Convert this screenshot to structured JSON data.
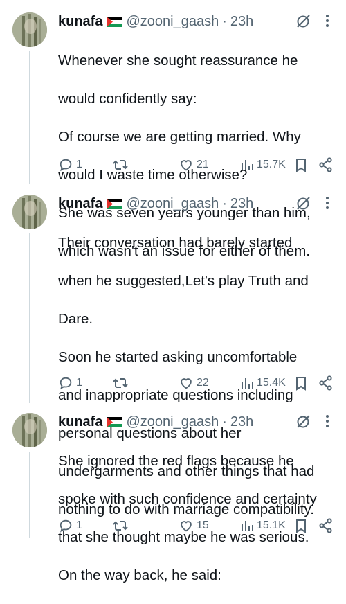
{
  "tweets": [
    {
      "name": "kunafa",
      "handle": "@zooni_gaash",
      "separator": "·",
      "time": "23h",
      "lines": [
        "Whenever she sought reassurance he",
        "would confidently say:",
        "Of course we are getting married. Why",
        "would I waste time otherwise?",
        "She was seven years younger than him,",
        "which wasn't an issue for either of them."
      ],
      "replies": "1",
      "likes": "21",
      "views": "15.7K"
    },
    {
      "name": "kunafa",
      "handle": "@zooni_gaash",
      "separator": "·",
      "time": "23h",
      "lines": [
        "Their conversation had barely started",
        "when he suggested,Let's play Truth and",
        "Dare.",
        "Soon he started asking uncomfortable",
        "and inappropriate questions including",
        "personal questions about her",
        "undergarments and other things that had",
        "nothing to do with marriage compatibility."
      ],
      "replies": "1",
      "likes": "22",
      "views": "15.4K"
    },
    {
      "name": "kunafa",
      "handle": "@zooni_gaash",
      "separator": "·",
      "time": "23h",
      "lines": [
        "She ignored the red flags because he",
        "spoke with such confidence and certainty",
        "that she thought maybe he was serious.",
        "On the way back, he said:"
      ],
      "replies": "1",
      "likes": "15",
      "views": "15.1K"
    }
  ],
  "icons": {
    "reply": "reply-icon",
    "retweet": "retweet-icon",
    "like": "heart-icon",
    "views": "views-chart-icon",
    "bookmark": "bookmark-icon",
    "share": "share-icon",
    "grok": "grok-icon",
    "more": "more-dots-icon"
  },
  "colors": {
    "text": "#0f1419",
    "secondary": "#536471",
    "thread_line": "#cfd9de",
    "flag_black": "#000000",
    "flag_green": "#149954",
    "flag_red": "#e4312b"
  }
}
